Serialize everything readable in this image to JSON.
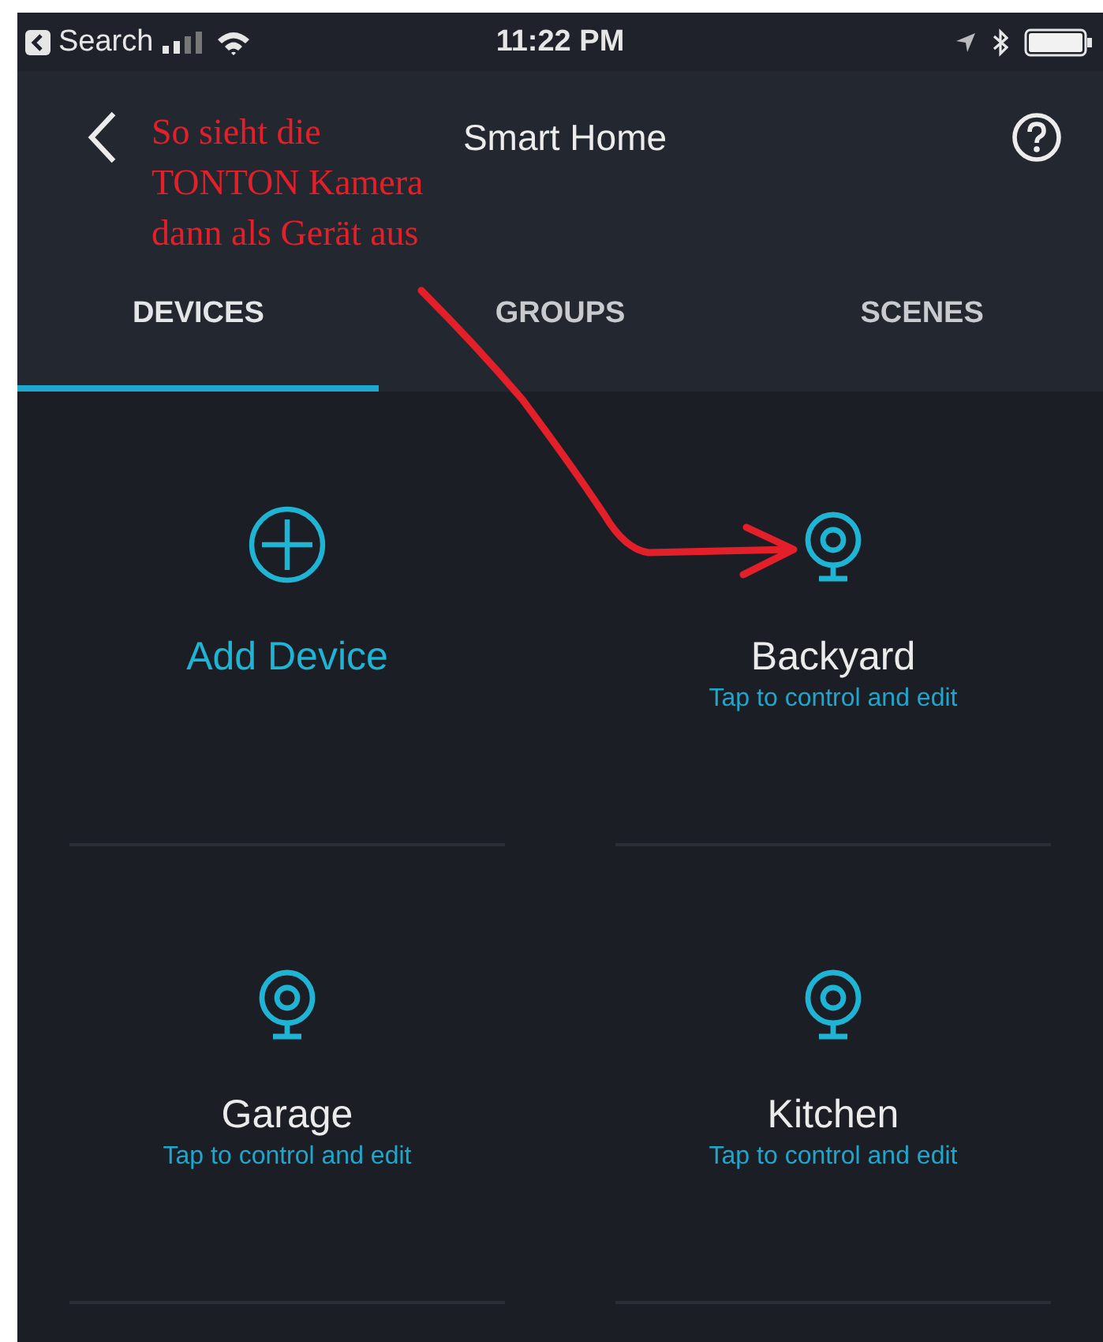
{
  "status_bar": {
    "back_app": "Search",
    "time": "11:22 PM"
  },
  "header": {
    "title": "Smart Home"
  },
  "tabs": [
    {
      "label": "DEVICES",
      "selected": true
    },
    {
      "label": "GROUPS",
      "selected": false
    },
    {
      "label": "SCENES",
      "selected": false
    }
  ],
  "tiles": [
    {
      "kind": "add",
      "label": "Add Device"
    },
    {
      "kind": "device",
      "name": "Backyard",
      "subtitle": "Tap to control and edit"
    },
    {
      "kind": "device",
      "name": "Garage",
      "subtitle": "Tap to control and edit"
    },
    {
      "kind": "device",
      "name": "Kitchen",
      "subtitle": "Tap to control and edit"
    }
  ],
  "annotation": {
    "lines": [
      "So sieht die",
      "TONTON Kamera",
      "dann als Gerät aus"
    ]
  }
}
